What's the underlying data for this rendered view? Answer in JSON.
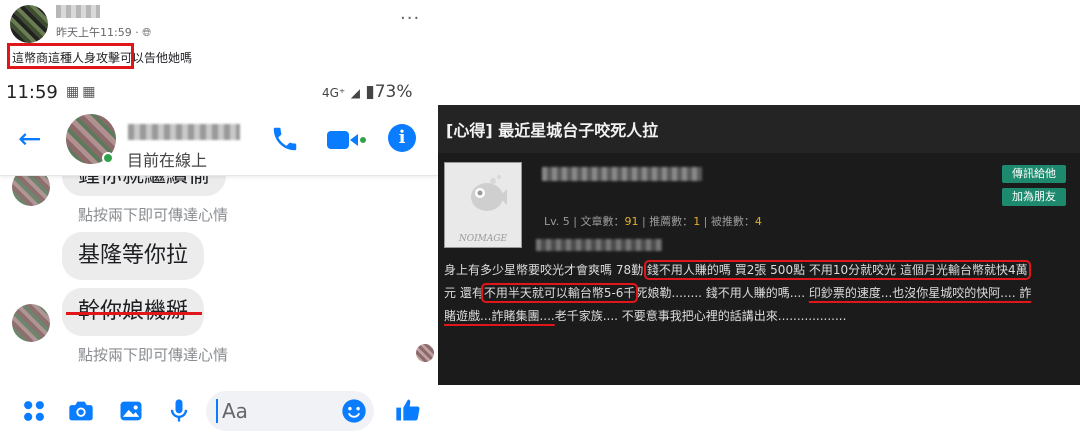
{
  "post": {
    "time": "昨天上午11:59 · ",
    "globe_icon": "globe-icon",
    "text_boxed": "這幣商這種人身攻",
    "text_rest": "擊可以告他她嗎",
    "more": "···"
  },
  "status_bar": {
    "time": "11:59",
    "network": "4G⁺",
    "battery": "73%",
    "icons": [
      "notification-icon",
      "notification-icon",
      "signal-icon",
      "battery-icon"
    ]
  },
  "chat_header": {
    "status": "目前在線上",
    "icons": [
      "back-arrow-icon",
      "phone-icon",
      "video-icon",
      "info-icon"
    ],
    "accent": "#0a7cff"
  },
  "messages": [
    {
      "text": "鍾你就繼續偷",
      "hint": ""
    },
    {
      "text": "",
      "hint": "點按兩下即可傳達心情"
    },
    {
      "text": "基隆等你拉",
      "hint": ""
    },
    {
      "text": "幹你娘機掰",
      "hint": "點按兩下即可傳達心情",
      "strikethrough": true
    }
  ],
  "composer": {
    "placeholder": "Aa",
    "icons": [
      "menu-dots-icon",
      "camera-icon",
      "image-icon",
      "microphone-icon",
      "emoji-icon",
      "thumbs-up-icon"
    ]
  },
  "forum": {
    "title": "[心得] 最近星城台子咬死人拉",
    "no_image_label": "NOIMAGE",
    "stats": {
      "level": "Lv. 5",
      "articles_label": "文章數：",
      "articles": "91",
      "recommends_label": "推薦數：",
      "recommends": "1",
      "recommended_label": "被推數：",
      "recommended": "4"
    },
    "buttons": {
      "message": "傳訊給他",
      "friend": "加為朋友"
    },
    "body": {
      "l1_a": "身上有多少星幣要咬光才會爽嗎 78勤 ",
      "l1_b": "錢不用人賺的嗎 買2張 500點 不用10分就咬光 這個月光輸台幣就快4萬",
      "l2_a": "元 還有",
      "l2_b": "不用半天就可以輸台幣5-6千",
      "l2_c": "死娘勒........ 錢不用人賺的嗎.... ",
      "l2_d": "印鈔票的速度...也沒你星城咬的快阿.... 詐",
      "l3_a": "賭遊戲...詐賭集團....",
      "l3_b": "老千家族.... 不要意事我把心裡的話講出來.................."
    },
    "colors": {
      "background": "#1b1b1b",
      "highlight": "#e0161b",
      "button": "#1d8a6e"
    }
  }
}
